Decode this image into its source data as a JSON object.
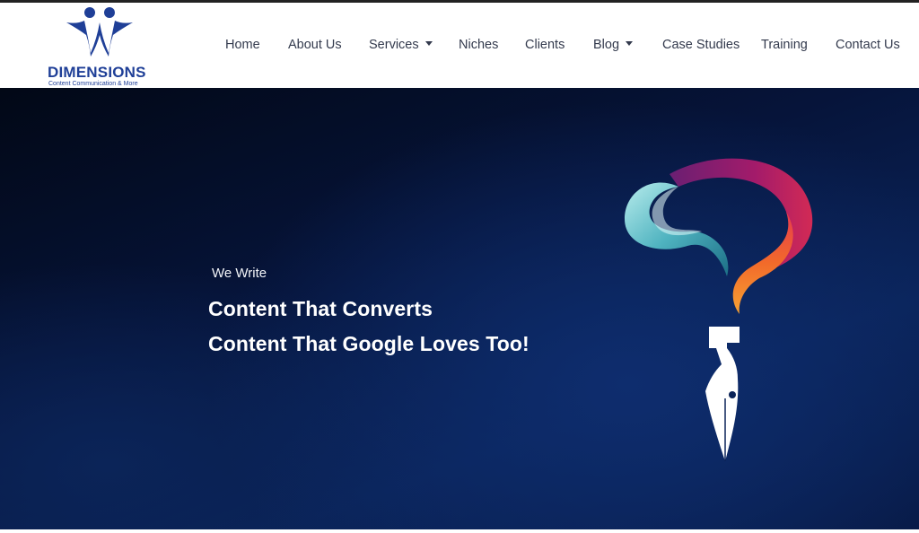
{
  "brand": {
    "name": "DIMENSIONS",
    "tagline": "Content  Communication & More",
    "color": "#1f3f97"
  },
  "nav": {
    "items": [
      {
        "label": "Home",
        "dropdown": false
      },
      {
        "label": "About Us",
        "dropdown": false
      },
      {
        "label": "Services",
        "dropdown": true
      },
      {
        "label": "Niches",
        "dropdown": false
      },
      {
        "label": "Clients",
        "dropdown": false
      },
      {
        "label": "Blog",
        "dropdown": true
      },
      {
        "label": "Case Studies",
        "dropdown": false
      },
      {
        "label": "Training",
        "dropdown": false
      },
      {
        "label": "Contact Us",
        "dropdown": false
      }
    ]
  },
  "hero": {
    "subtitle": "We Write",
    "line1": "Content That Converts",
    "line2": "Content That Google Loves Too!",
    "background_color": "#06143a",
    "art_icon": "brain-pen-icon"
  }
}
